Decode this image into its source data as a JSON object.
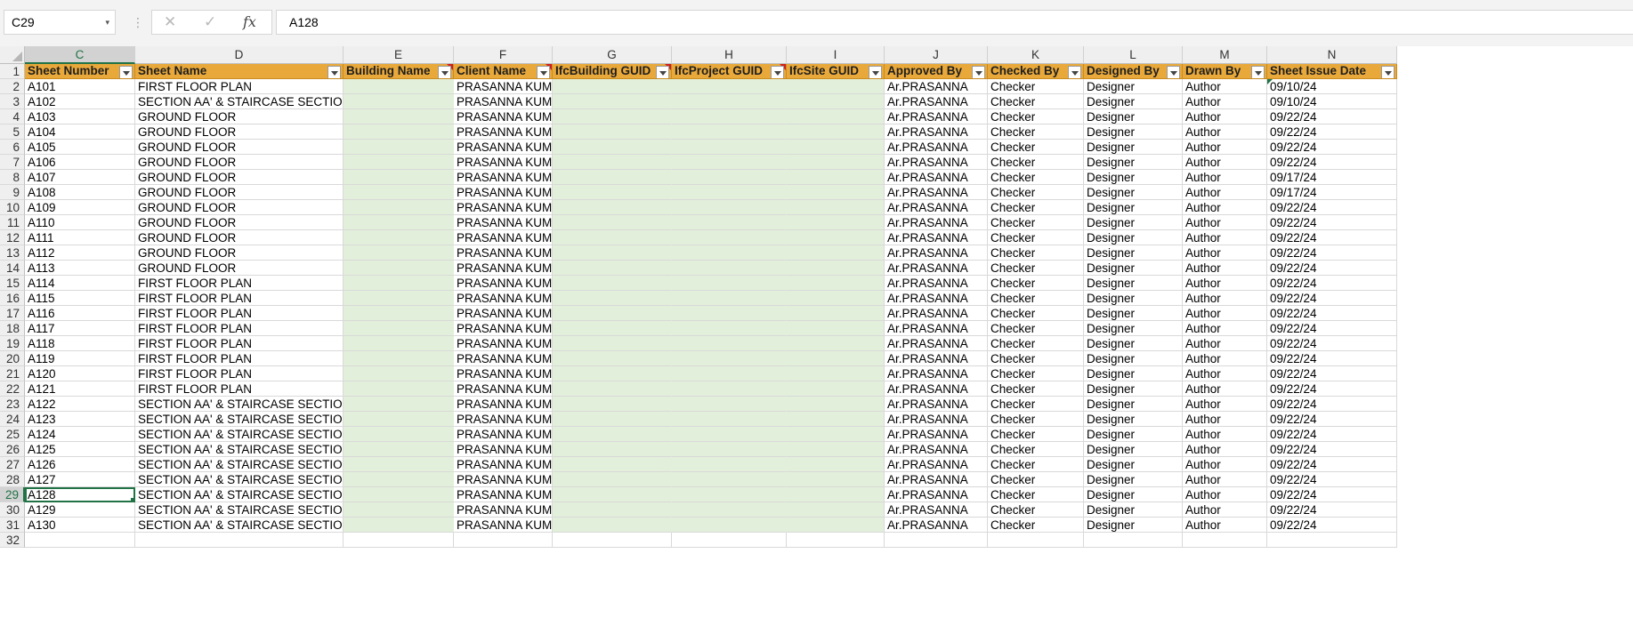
{
  "formula_bar": {
    "name_box": "C29",
    "formula": "A128",
    "separator": "⋮"
  },
  "icons": {
    "cancel": "✕",
    "enter": "✓",
    "fx": "fx",
    "dropdown": "▾"
  },
  "columns": [
    {
      "letter": "C",
      "header": "Sheet Number",
      "comment": false
    },
    {
      "letter": "D",
      "header": "Sheet Name",
      "comment": false
    },
    {
      "letter": "E",
      "header": "Building Name",
      "comment": true
    },
    {
      "letter": "F",
      "header": "Client Name",
      "comment": true
    },
    {
      "letter": "G",
      "header": "IfcBuilding GUID",
      "comment": true
    },
    {
      "letter": "H",
      "header": "IfcProject GUID",
      "comment": true
    },
    {
      "letter": "I",
      "header": "IfcSite GUID",
      "comment": false
    },
    {
      "letter": "J",
      "header": "Approved By",
      "comment": false
    },
    {
      "letter": "K",
      "header": "Checked By",
      "comment": false
    },
    {
      "letter": "L",
      "header": "Designed By",
      "comment": false
    },
    {
      "letter": "M",
      "header": "Drawn By",
      "comment": false
    },
    {
      "letter": "N",
      "header": "Sheet Issue Date",
      "comment": false
    }
  ],
  "rows": [
    {
      "num": "2",
      "cells": [
        "A101",
        "FIRST FLOOR PLAN",
        "",
        "PRASANNA KUMAR",
        "",
        "",
        "",
        "Ar.PRASANNA",
        "Checker",
        "Designer",
        "Author",
        "09/10/24"
      ]
    },
    {
      "num": "3",
      "cells": [
        "A102",
        "SECTION AA' & STAIRCASE SECTION",
        "",
        "PRASANNA KUMAR",
        "",
        "",
        "",
        "Ar.PRASANNA",
        "Checker",
        "Designer",
        "Author",
        "09/10/24"
      ]
    },
    {
      "num": "4",
      "cells": [
        "A103",
        "GROUND FLOOR",
        "",
        "PRASANNA KUMAR",
        "",
        "",
        "",
        "Ar.PRASANNA",
        "Checker",
        "Designer",
        "Author",
        "09/22/24"
      ]
    },
    {
      "num": "5",
      "cells": [
        "A104",
        "GROUND FLOOR",
        "",
        "PRASANNA KUMAR",
        "",
        "",
        "",
        "Ar.PRASANNA",
        "Checker",
        "Designer",
        "Author",
        "09/22/24"
      ]
    },
    {
      "num": "6",
      "cells": [
        "A105",
        "GROUND FLOOR",
        "",
        "PRASANNA KUMAR",
        "",
        "",
        "",
        "Ar.PRASANNA",
        "Checker",
        "Designer",
        "Author",
        "09/22/24"
      ]
    },
    {
      "num": "7",
      "cells": [
        "A106",
        "GROUND FLOOR",
        "",
        "PRASANNA KUMAR",
        "",
        "",
        "",
        "Ar.PRASANNA",
        "Checker",
        "Designer",
        "Author",
        "09/22/24"
      ]
    },
    {
      "num": "8",
      "cells": [
        "A107",
        "GROUND FLOOR",
        "",
        "PRASANNA KUMAR",
        "",
        "",
        "",
        "Ar.PRASANNA",
        "Checker",
        "Designer",
        "Author",
        "09/17/24"
      ]
    },
    {
      "num": "9",
      "cells": [
        "A108",
        "GROUND FLOOR",
        "",
        "PRASANNA KUMAR",
        "",
        "",
        "",
        "Ar.PRASANNA",
        "Checker",
        "Designer",
        "Author",
        "09/17/24"
      ]
    },
    {
      "num": "10",
      "cells": [
        "A109",
        "GROUND FLOOR",
        "",
        "PRASANNA KUMAR",
        "",
        "",
        "",
        "Ar.PRASANNA",
        "Checker",
        "Designer",
        "Author",
        "09/22/24"
      ]
    },
    {
      "num": "11",
      "cells": [
        "A110",
        "GROUND FLOOR",
        "",
        "PRASANNA KUMAR",
        "",
        "",
        "",
        "Ar.PRASANNA",
        "Checker",
        "Designer",
        "Author",
        "09/22/24"
      ]
    },
    {
      "num": "12",
      "cells": [
        "A111",
        "GROUND FLOOR",
        "",
        "PRASANNA KUMAR",
        "",
        "",
        "",
        "Ar.PRASANNA",
        "Checker",
        "Designer",
        "Author",
        "09/22/24"
      ]
    },
    {
      "num": "13",
      "cells": [
        "A112",
        "GROUND FLOOR",
        "",
        "PRASANNA KUMAR",
        "",
        "",
        "",
        "Ar.PRASANNA",
        "Checker",
        "Designer",
        "Author",
        "09/22/24"
      ]
    },
    {
      "num": "14",
      "cells": [
        "A113",
        "GROUND FLOOR",
        "",
        "PRASANNA KUMAR",
        "",
        "",
        "",
        "Ar.PRASANNA",
        "Checker",
        "Designer",
        "Author",
        "09/22/24"
      ]
    },
    {
      "num": "15",
      "cells": [
        "A114",
        "FIRST FLOOR PLAN",
        "",
        "PRASANNA KUMAR",
        "",
        "",
        "",
        "Ar.PRASANNA",
        "Checker",
        "Designer",
        "Author",
        "09/22/24"
      ]
    },
    {
      "num": "16",
      "cells": [
        "A115",
        "FIRST FLOOR PLAN",
        "",
        "PRASANNA KUMAR",
        "",
        "",
        "",
        "Ar.PRASANNA",
        "Checker",
        "Designer",
        "Author",
        "09/22/24"
      ]
    },
    {
      "num": "17",
      "cells": [
        "A116",
        "FIRST FLOOR PLAN",
        "",
        "PRASANNA KUMAR",
        "",
        "",
        "",
        "Ar.PRASANNA",
        "Checker",
        "Designer",
        "Author",
        "09/22/24"
      ]
    },
    {
      "num": "18",
      "cells": [
        "A117",
        "FIRST FLOOR PLAN",
        "",
        "PRASANNA KUMAR",
        "",
        "",
        "",
        "Ar.PRASANNA",
        "Checker",
        "Designer",
        "Author",
        "09/22/24"
      ]
    },
    {
      "num": "19",
      "cells": [
        "A118",
        "FIRST FLOOR PLAN",
        "",
        "PRASANNA KUMAR",
        "",
        "",
        "",
        "Ar.PRASANNA",
        "Checker",
        "Designer",
        "Author",
        "09/22/24"
      ]
    },
    {
      "num": "20",
      "cells": [
        "A119",
        "FIRST FLOOR PLAN",
        "",
        "PRASANNA KUMAR",
        "",
        "",
        "",
        "Ar.PRASANNA",
        "Checker",
        "Designer",
        "Author",
        "09/22/24"
      ]
    },
    {
      "num": "21",
      "cells": [
        "A120",
        "FIRST FLOOR PLAN",
        "",
        "PRASANNA KUMAR",
        "",
        "",
        "",
        "Ar.PRASANNA",
        "Checker",
        "Designer",
        "Author",
        "09/22/24"
      ]
    },
    {
      "num": "22",
      "cells": [
        "A121",
        "FIRST FLOOR PLAN",
        "",
        "PRASANNA KUMAR",
        "",
        "",
        "",
        "Ar.PRASANNA",
        "Checker",
        "Designer",
        "Author",
        "09/22/24"
      ]
    },
    {
      "num": "23",
      "cells": [
        "A122",
        "SECTION AA' & STAIRCASE SECTION",
        "",
        "PRASANNA KUMAR",
        "",
        "",
        "",
        "Ar.PRASANNA",
        "Checker",
        "Designer",
        "Author",
        "09/22/24"
      ]
    },
    {
      "num": "24",
      "cells": [
        "A123",
        "SECTION AA' & STAIRCASE SECTION",
        "",
        "PRASANNA KUMAR",
        "",
        "",
        "",
        "Ar.PRASANNA",
        "Checker",
        "Designer",
        "Author",
        "09/22/24"
      ]
    },
    {
      "num": "25",
      "cells": [
        "A124",
        "SECTION AA' & STAIRCASE SECTION",
        "",
        "PRASANNA KUMAR",
        "",
        "",
        "",
        "Ar.PRASANNA",
        "Checker",
        "Designer",
        "Author",
        "09/22/24"
      ]
    },
    {
      "num": "26",
      "cells": [
        "A125",
        "SECTION AA' & STAIRCASE SECTION",
        "",
        "PRASANNA KUMAR",
        "",
        "",
        "",
        "Ar.PRASANNA",
        "Checker",
        "Designer",
        "Author",
        "09/22/24"
      ]
    },
    {
      "num": "27",
      "cells": [
        "A126",
        "SECTION AA' & STAIRCASE SECTION",
        "",
        "PRASANNA KUMAR",
        "",
        "",
        "",
        "Ar.PRASANNA",
        "Checker",
        "Designer",
        "Author",
        "09/22/24"
      ]
    },
    {
      "num": "28",
      "cells": [
        "A127",
        "SECTION AA' & STAIRCASE SECTION",
        "",
        "PRASANNA KUMAR",
        "",
        "",
        "",
        "Ar.PRASANNA",
        "Checker",
        "Designer",
        "Author",
        "09/22/24"
      ]
    },
    {
      "num": "29",
      "cells": [
        "A128",
        "SECTION AA' & STAIRCASE SECTION",
        "",
        "PRASANNA KUMAR",
        "",
        "",
        "",
        "Ar.PRASANNA",
        "Checker",
        "Designer",
        "Author",
        "09/22/24"
      ]
    },
    {
      "num": "30",
      "cells": [
        "A129",
        "SECTION AA' & STAIRCASE SECTION",
        "",
        "PRASANNA KUMAR",
        "",
        "",
        "",
        "Ar.PRASANNA",
        "Checker",
        "Designer",
        "Author",
        "09/22/24"
      ]
    },
    {
      "num": "31",
      "cells": [
        "A130",
        "SECTION AA' & STAIRCASE SECTION",
        "",
        "PRASANNA KUMAR",
        "",
        "",
        "",
        "Ar.PRASANNA",
        "Checker",
        "Designer",
        "Author",
        "09/22/24"
      ]
    }
  ],
  "empty_row_num": "32",
  "header_row_num": "1",
  "active_cell": {
    "row": "29",
    "col": "C"
  },
  "colors": {
    "header_fill": "#e9a93a",
    "guid_fill": "#e2efda",
    "selection": "#217346",
    "comment_marker": "#d11d1d"
  }
}
